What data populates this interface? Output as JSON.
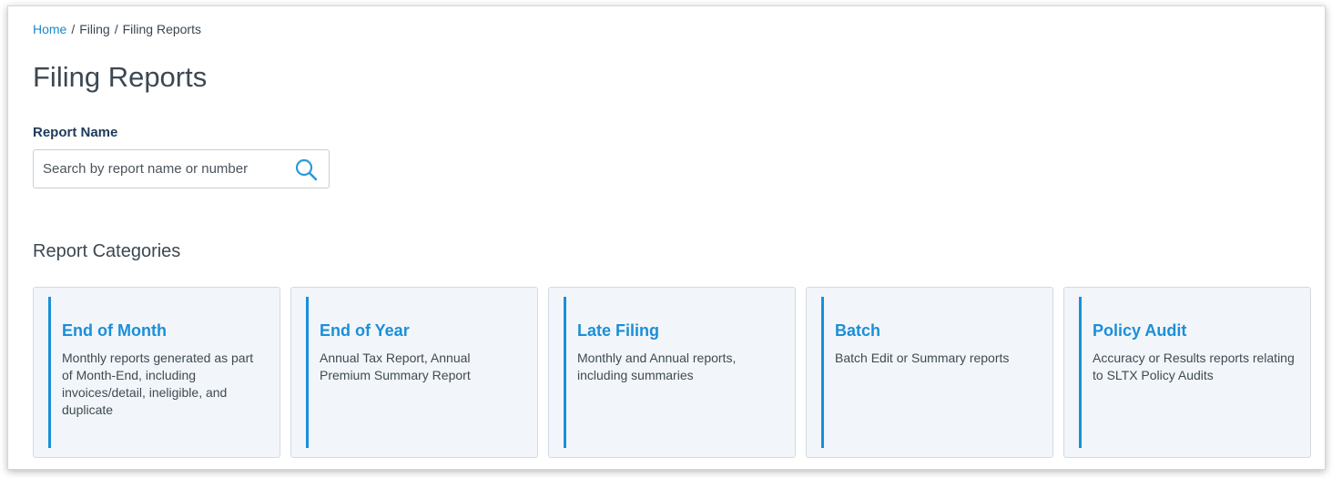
{
  "breadcrumb": {
    "items": [
      "Home",
      "Filing",
      "Filing Reports"
    ],
    "separator": "/"
  },
  "page": {
    "title": "Filing Reports"
  },
  "search": {
    "label": "Report Name",
    "placeholder": "Search by report name or number",
    "value": "",
    "icon": "search-icon"
  },
  "categories": {
    "heading": "Report Categories",
    "items": [
      {
        "title": "End of Month",
        "description": "Monthly reports generated as part of Month-End, including invoices/detail, ineligible, and duplicate"
      },
      {
        "title": "End of Year",
        "description": "Annual Tax Report, Annual Premium Summary Report"
      },
      {
        "title": "Late Filing",
        "description": "Monthly and Annual reports, including summaries"
      },
      {
        "title": "Batch",
        "description": "Batch Edit or Summary reports"
      },
      {
        "title": "Policy Audit",
        "description": "Accuracy or Results reports relating to SLTX Policy Audits"
      }
    ]
  },
  "colors": {
    "accent": "#1b8fd8",
    "link": "#1e88c9",
    "card_bg": "#f2f6fa",
    "label": "#1e3a5a"
  }
}
